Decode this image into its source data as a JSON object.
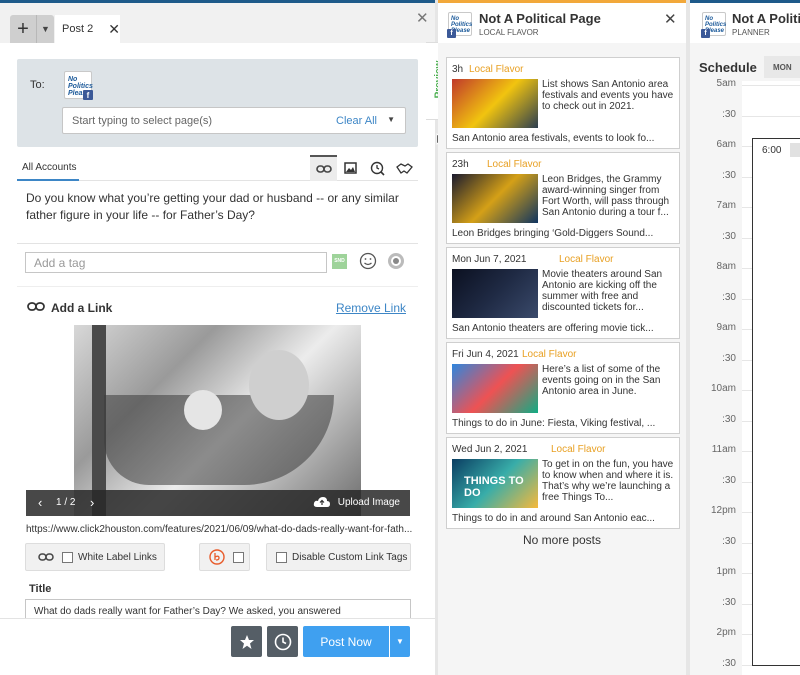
{
  "composer": {
    "tab_label": "Post 2",
    "to_label": "To:",
    "avatar_text": "No Politics Please",
    "page_select_placeholder": "Start typing to select page(s)",
    "clear_all": "Clear All",
    "accounts_tab": "All Accounts",
    "message": "Do you know what you’re getting your dad or husband -- or any similar father figure in your life -- for Father’s Day?",
    "tag_placeholder": "Add a tag",
    "snd_label": "SND",
    "link": {
      "heading": "Add a Link",
      "remove": "Remove Link",
      "image_counter": "1 / 2",
      "upload": "Upload Image",
      "url": "https://www.click2houston.com/features/2021/06/09/what-do-dads-really-want-for-fath...",
      "white_label": "White Label Links",
      "disable_tags": "Disable Custom Link Tags",
      "title_label": "Title",
      "title_value": "What do dads really want for Father’s Day? We asked, you answered"
    },
    "post_now": "Post Now"
  },
  "preview_tab": "Preview",
  "feed": {
    "title": "Not A Political Page",
    "subtitle": "LOCAL FLAVOR",
    "cards": [
      {
        "when": "3h",
        "category": "Local Flavor",
        "desc": "List shows San Antonio area festivals and events you have to check out in 2021.",
        "title": "San Antonio area festivals, events to look fo...",
        "thumb_colors": [
          "#c0392b",
          "#f1c40f",
          "#2c3e50"
        ]
      },
      {
        "when": "23h",
        "category": "Local Flavor",
        "desc": "Leon Bridges, the Grammy award-winning singer from Fort Worth, will pass through San Antonio during a tour f...",
        "title": "Leon Bridges bringing ‘Gold-Diggers Sound...",
        "thumb_colors": [
          "#1a1a2e",
          "#d4a017",
          "#0f3460"
        ]
      },
      {
        "when": "Mon Jun 7, 2021",
        "category": "Local Flavor",
        "desc": "Movie theaters around San Antonio are kicking off the summer with free and discounted tickets for...",
        "title": "San Antonio theaters are offering movie tick...",
        "thumb_colors": [
          "#0b1020",
          "#1f2a44",
          "#3a4a6b"
        ]
      },
      {
        "when": "Fri Jun 4, 2021",
        "category": "Local Flavor",
        "desc": "Here’s a list of some of the events going on in the San Antonio area in June.",
        "title": "Things to do in June: Fiesta, Viking festival, ...",
        "thumb_colors": [
          "#2e86de",
          "#ee5253",
          "#10ac84"
        ]
      },
      {
        "when": "Wed Jun 2, 2021",
        "category": "Local Flavor",
        "desc": "To get in on the fun, you have to know when and where it is. That’s why we’re launching a free Things To...",
        "title": "Things to do in and around San Antonio eac...",
        "thumb_colors": [
          "#0a3d62",
          "#38ada9",
          "#f6b93b"
        ],
        "thumb_text": "THINGS TO DO"
      }
    ],
    "no_more": "No more posts"
  },
  "planner": {
    "title": "Not A Politi",
    "subtitle": "PLANNER",
    "schedule": "Schedule",
    "day_tab": "MON",
    "times": [
      "5am",
      ":30",
      "6am",
      ":30",
      "7am",
      ":30",
      "8am",
      ":30",
      "9am",
      ":30",
      "10am",
      ":30",
      "11am",
      ":30",
      "12pm",
      ":30",
      "1pm",
      ":30",
      "2pm",
      ":30"
    ],
    "event_time": "6:00"
  }
}
